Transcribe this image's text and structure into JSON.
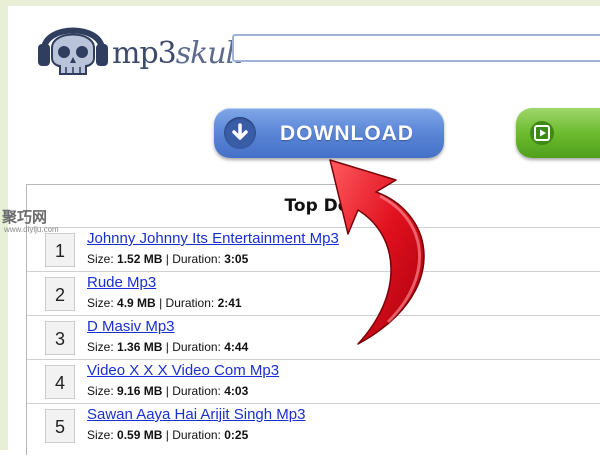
{
  "header": {
    "logo_text_a": "mp3",
    "logo_text_b": "skull",
    "search_value": ""
  },
  "buttons": {
    "download_label": "DOWNLOAD",
    "download_icon": "arrow-down-circle-icon",
    "play_icon": "play-icon"
  },
  "panel": {
    "title": "Top Do"
  },
  "labels": {
    "size": "Size:",
    "duration": "Duration:",
    "sep": "|"
  },
  "tracks": [
    {
      "num": "1",
      "title": "Johnny Johnny Its Entertainment Mp3",
      "size": "1.52 MB",
      "duration": "3:05"
    },
    {
      "num": "2",
      "title": "Rude Mp3",
      "size": "4.9 MB",
      "duration": "2:41"
    },
    {
      "num": "3",
      "title": "D Masiv Mp3",
      "size": "1.36 MB",
      "duration": "4:44"
    },
    {
      "num": "4",
      "title": "Video X X X Video Com Mp3",
      "size": "9.16 MB",
      "duration": "4:03"
    },
    {
      "num": "5",
      "title": "Sawan Aaya Hai Arijit Singh Mp3",
      "size": "0.59 MB",
      "duration": "0:25"
    }
  ],
  "watermark": {
    "cn": "聚巧网",
    "url": "www.diyiju.com"
  },
  "colors": {
    "link": "#1a2fd1",
    "download_button": "#5b86d6",
    "play_button": "#6cbb2f",
    "arrow": "#e0101e"
  }
}
